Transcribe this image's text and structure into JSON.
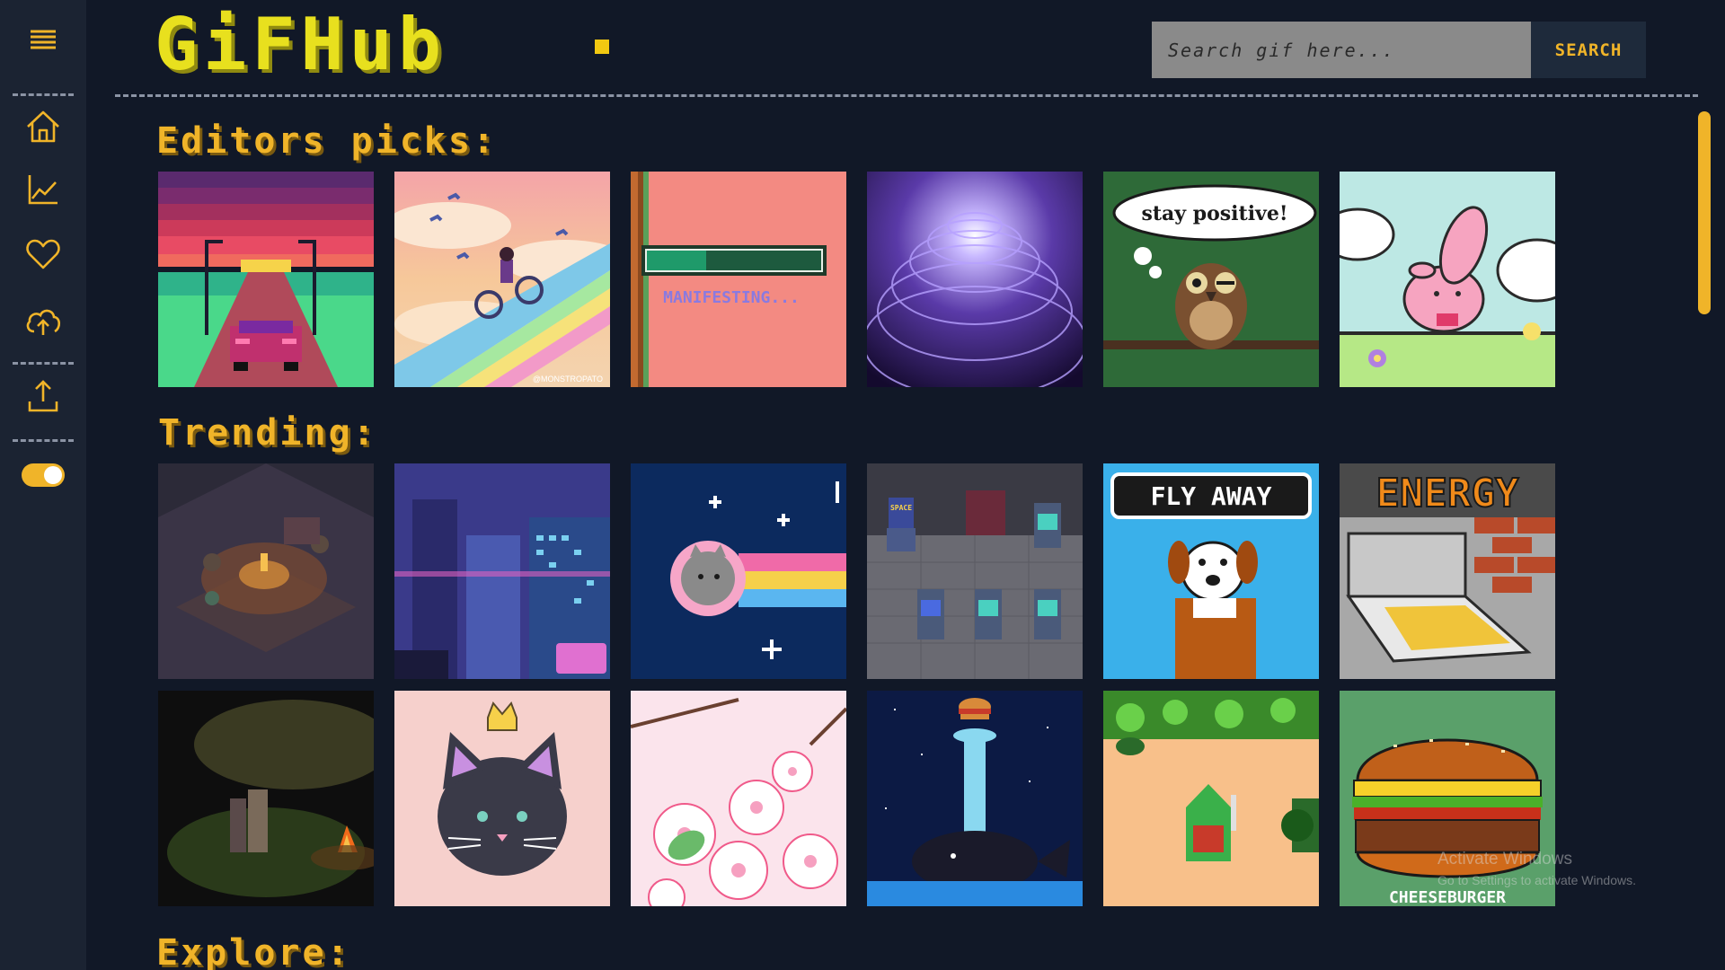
{
  "app": {
    "logo": "GiFHub",
    "colors": {
      "accent": "#f0b429",
      "logo": "#e8e01e",
      "background": "#111827",
      "sidebar": "#1b2332"
    }
  },
  "sidebar": {
    "items": [
      {
        "icon": "menu-icon"
      },
      {
        "icon": "home-icon"
      },
      {
        "icon": "trending-chart-icon"
      },
      {
        "icon": "heart-icon"
      },
      {
        "icon": "cloud-upload-icon"
      },
      {
        "icon": "upload-icon"
      }
    ],
    "theme_toggle": {
      "on": true
    }
  },
  "search": {
    "placeholder": "Search gif here...",
    "button_label": "SEARCH"
  },
  "sections": {
    "editors_picks": {
      "title": "Editors picks:",
      "tiles": [
        {
          "icon": "synthwave-car-gif"
        },
        {
          "icon": "girl-bicycle-clouds-gif",
          "caption": "@MONSTROPATO"
        },
        {
          "icon": "manifesting-progress-gif",
          "caption": "MANIFESTING..."
        },
        {
          "icon": "purple-vortex-gif"
        },
        {
          "icon": "owl-stay-positive-gif",
          "caption": "stay positive!"
        },
        {
          "icon": "pink-bunny-gif"
        }
      ]
    },
    "trending": {
      "title": "Trending:",
      "tiles": [
        {
          "icon": "isometric-room-gif"
        },
        {
          "icon": "cyberpunk-city-gif"
        },
        {
          "icon": "nyan-pusheen-gif"
        },
        {
          "icon": "arcade-room-gif",
          "caption": "SPACE"
        },
        {
          "icon": "fly-away-duck-hunt-dog-gif",
          "caption": "FLY AWAY"
        },
        {
          "icon": "energy-pizza-gif",
          "caption": "ENERGY"
        },
        {
          "icon": "campfire-forest-gif"
        },
        {
          "icon": "black-cat-crown-gif"
        },
        {
          "icon": "cherry-blossoms-gif"
        },
        {
          "icon": "whale-burger-gif"
        },
        {
          "icon": "zelda-link-gif"
        },
        {
          "icon": "cheeseburger-gif",
          "caption": "CHEESEBURGER"
        }
      ]
    },
    "explore": {
      "title": "Explore:"
    }
  },
  "watermark": {
    "line1": "Activate Windows",
    "line2": "Go to Settings to activate Windows."
  }
}
